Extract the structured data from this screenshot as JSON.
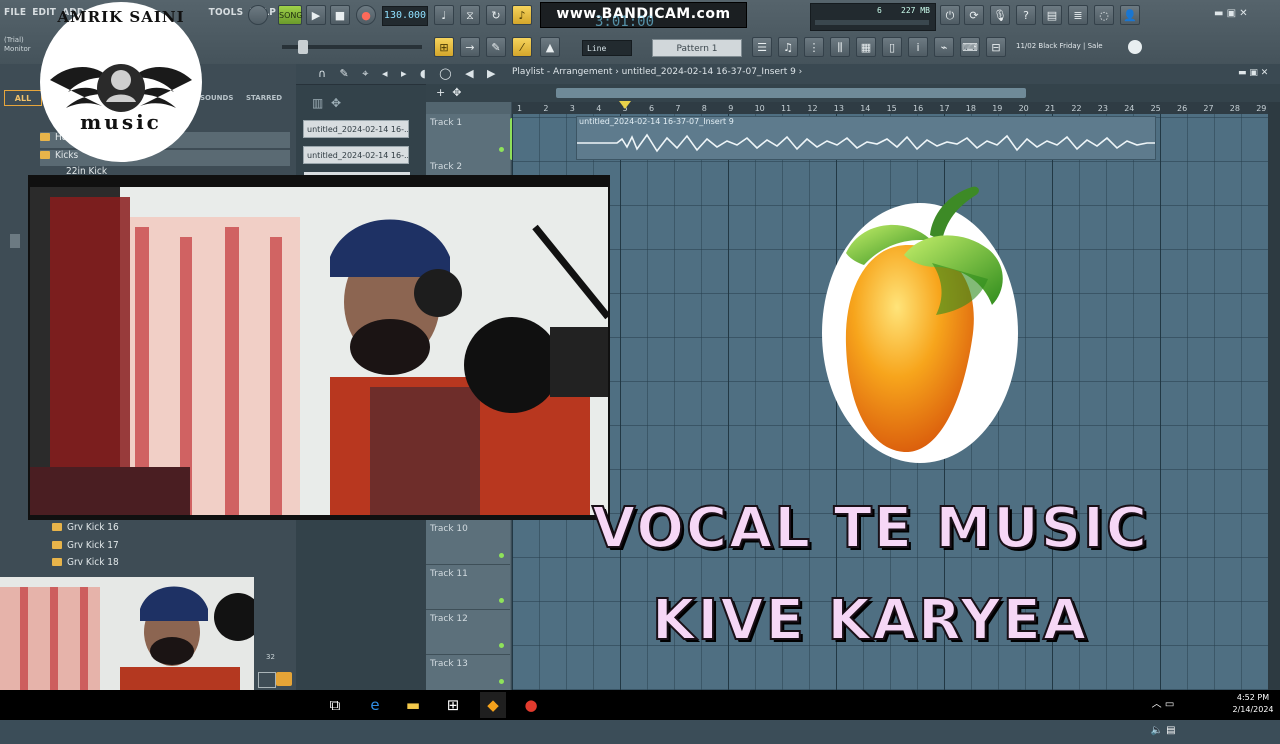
{
  "menu": [
    "FILE",
    "EDIT",
    "ADD",
    "",
    "",
    "TOOLS",
    "HELP"
  ],
  "toolbar": {
    "tempo": "130.000",
    "bandicam": "www.BANDICAM.com",
    "time_display": "3:01:00",
    "memory": "227 MB",
    "cpu": "6",
    "mode": "Line",
    "pattern": "Pattern 1",
    "news": "11/02  Black Friday | Sale",
    "trial_label": "(Trial)",
    "monitor_label": "Monitor"
  },
  "browser": {
    "tabs": [
      "ALL",
      "SOUNDS",
      "STARRED"
    ],
    "items": [
      "Hats",
      "Kicks",
      "22in Kick",
      "Grv Kick 16",
      "Grv Kick 17",
      "Grv Kick 18"
    ],
    "footer_value": "32"
  },
  "patterns": [
    "untitled_2024-02-14 16-...",
    "untitled_2024-02-14 16-..."
  ],
  "playlist": {
    "title": "Playlist - Arrangement › untitled_2024-02-14 16-37-07_Insert 9 ›",
    "clip_label": "untitled_2024-02-14 16-37-07_Insert 9",
    "ruler": [
      "1",
      "2",
      "3",
      "4",
      "5",
      "6",
      "7",
      "8",
      "9",
      "10",
      "11",
      "12",
      "13",
      "14",
      "15",
      "16",
      "17",
      "18",
      "19",
      "20",
      "21",
      "22",
      "23",
      "24",
      "25",
      "26",
      "27",
      "28",
      "29"
    ],
    "tracks": [
      "Track 1",
      "Track 2",
      "Track 10",
      "Track 11",
      "Track 12",
      "Track 13"
    ]
  },
  "overlay": {
    "logo_top": "AMRIK SAINI",
    "logo_bottom": "music",
    "title_line1": "VOCAL TE MUSIC",
    "title_line2": "KIVE KARYEA",
    "title_color": "#f6d7f6"
  },
  "taskbar": {
    "time": "4:52 PM",
    "date": "2/14/2024"
  }
}
